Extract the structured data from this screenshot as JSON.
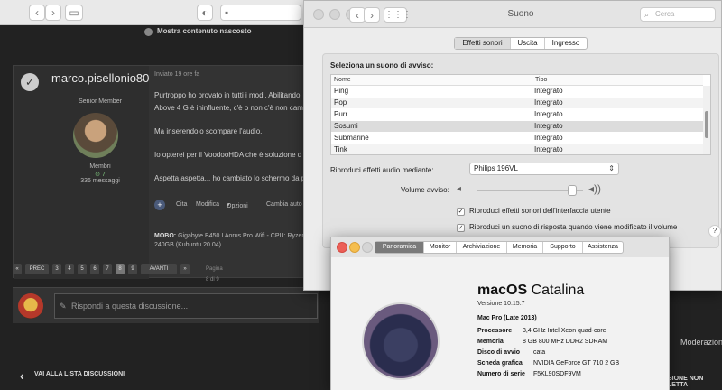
{
  "forum": {
    "hidden_content": "Mostra contenuto nascosto",
    "username": "marco.pisellonio80",
    "role": "Senior Member",
    "group": "Membri",
    "reputation": "7",
    "message_count": "336 messaggi",
    "post_time": "Inviato 19 ore fa",
    "post_lines": [
      "Purtroppo ho provato in tutti i modi. Abilitando",
      "Above 4 G è ininfluente, c'è o non c'è non camb",
      "Ma inserendolo scompare l'audio.",
      "Io opterei per il VoodooHDA che è soluzione d",
      "Aspetta aspetta... ho cambiato lo schermo da p"
    ],
    "actions": [
      "Cita",
      "Modifica",
      "Opzioni",
      "Cambia auto"
    ],
    "signature_label": "MOBO:",
    "signature_text": "Gigabyte B450 I Aorus Pro Wifi - CPU: Ryzen",
    "signature_line2": "240GB (Kubuntu 20.04)",
    "pagination": [
      "«",
      "PREC",
      "3",
      "4",
      "5",
      "6",
      "7",
      "8",
      "9",
      "AVANTI",
      "»"
    ],
    "page_of": "Pagina 8 di 9",
    "reply_placeholder": "Rispondi a questa discussione...",
    "back_label": "VAI ALLA LISTA DISCUSSIONI",
    "moderation": "Moderazione",
    "mark_unread": "SIONE NON LETTA"
  },
  "sound": {
    "title": "Suono",
    "search_placeholder": "Cerca",
    "tabs": [
      "Effetti sonori",
      "Uscita",
      "Ingresso"
    ],
    "select_label": "Seleziona un suono di avviso:",
    "columns": [
      "Nome",
      "Tipo"
    ],
    "rows": [
      {
        "name": "Ping",
        "type": "Integrato"
      },
      {
        "name": "Pop",
        "type": "Integrato"
      },
      {
        "name": "Purr",
        "type": "Integrato"
      },
      {
        "name": "Sosumi",
        "type": "Integrato"
      },
      {
        "name": "Submarine",
        "type": "Integrato"
      },
      {
        "name": "Tink",
        "type": "Integrato"
      }
    ],
    "output_label": "Riproduci effetti audio mediante:",
    "output_device": "Philips 196VL",
    "volume_label": "Volume avviso:",
    "volume_level": 0.9,
    "checkbox1": "Riproduci effetti sonori dell'interfaccia utente",
    "checkbox2": "Riproduci un suono di risposta quando viene modificato il volume",
    "help": "?"
  },
  "about": {
    "tabs": [
      "Panoramica",
      "Monitor",
      "Archiviazione",
      "Memoria",
      "Supporto",
      "Assistenza"
    ],
    "os_name": "macOS",
    "os_release": "Catalina",
    "version": "Versione 10.15.7",
    "model": "Mac Pro (Late 2013)",
    "specs": [
      {
        "label": "Processore",
        "value": "3,4 GHz Intel Xeon quad-core"
      },
      {
        "label": "Memoria",
        "value": "8 GB 800 MHz DDR2 SDRAM"
      },
      {
        "label": "Disco di avvio",
        "value": "cata"
      },
      {
        "label": "Scheda grafica",
        "value": "NVIDIA GeForce GT 710 2 GB"
      },
      {
        "label": "Numero di serie",
        "value": "F5KL90SDF9VM"
      }
    ]
  }
}
